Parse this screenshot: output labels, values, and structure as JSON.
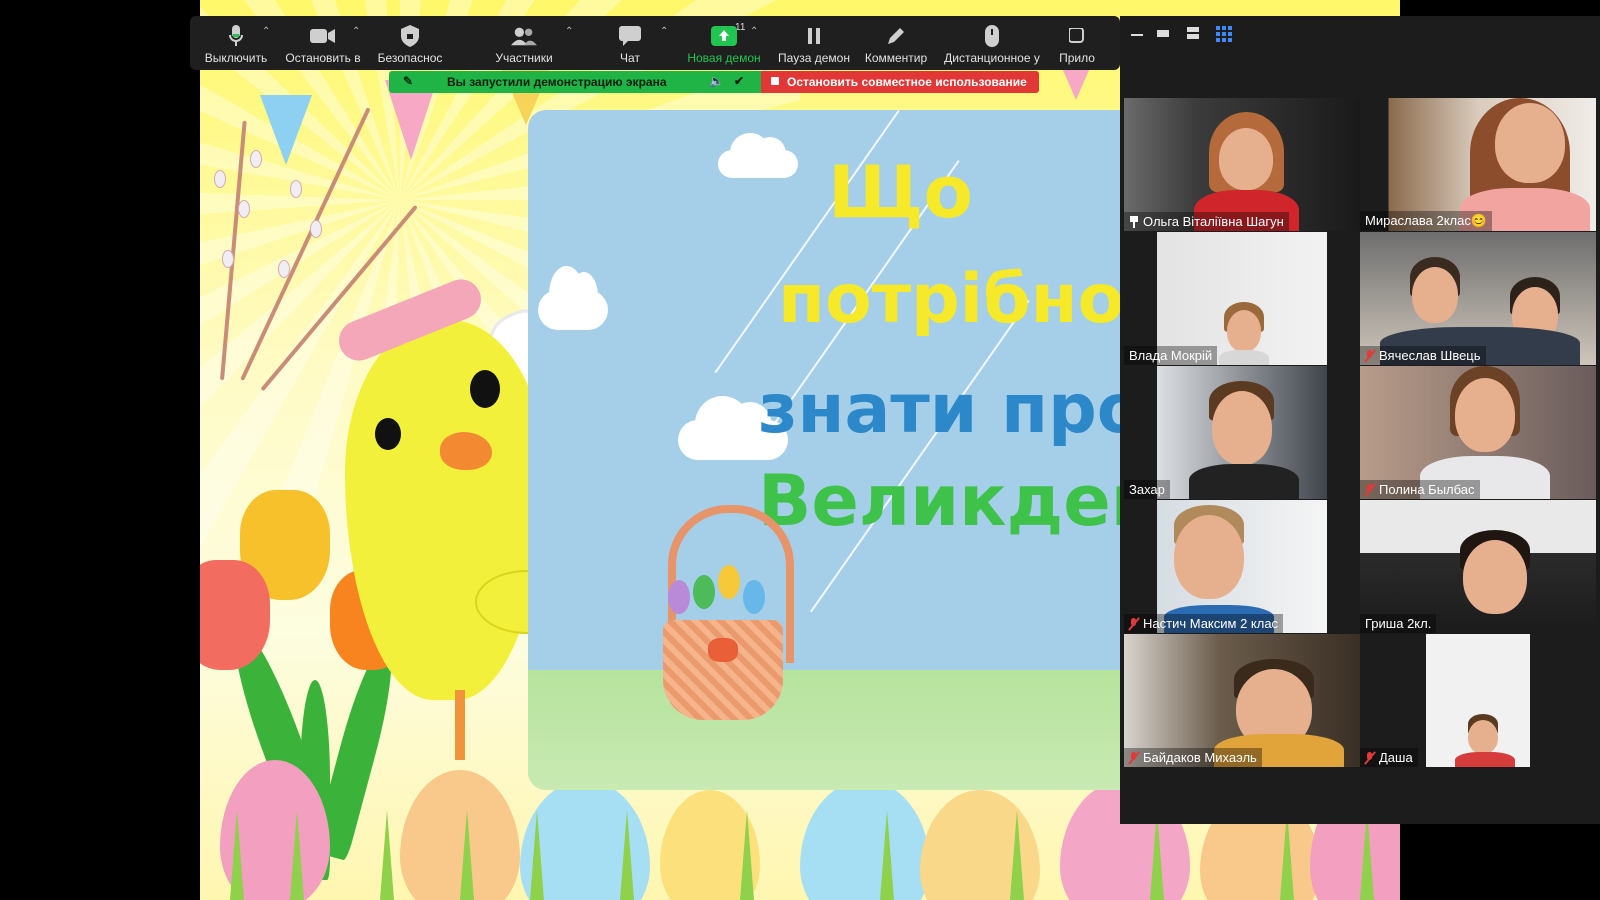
{
  "toolbar": {
    "items": [
      {
        "label": "Выключить",
        "icon": "microphone-icon"
      },
      {
        "label": "Остановить в",
        "icon": "video-camera-icon"
      },
      {
        "label": "Безопаснос",
        "icon": "shield-icon"
      },
      {
        "label": "Участники",
        "icon": "participants-icon",
        "count": "11"
      },
      {
        "label": "Чат",
        "icon": "chat-icon"
      },
      {
        "label": "Новая демон",
        "icon": "share-screen-icon",
        "accent": "#23c552"
      },
      {
        "label": "Пауза демон",
        "icon": "pause-icon"
      },
      {
        "label": "Комментир",
        "icon": "annotate-pencil-icon"
      },
      {
        "label": "Дистанционное у",
        "icon": "remote-control-mouse-icon"
      },
      {
        "label": "Прило",
        "icon": "apps-icon"
      }
    ]
  },
  "share_banner": {
    "text": "Вы запустили демонстрацию экрана",
    "stop_label": "Остановить совместное использование",
    "colors": {
      "banner": "#20b447",
      "stop": "#e13737"
    }
  },
  "video": {
    "title_lines": [
      "Що",
      "потрібно",
      "знати про",
      "Великдень"
    ]
  },
  "gallery": {
    "participants": [
      {
        "name": "Ольга Віталіївна Шагун",
        "pinned": true,
        "muted": false,
        "active": true
      },
      {
        "name": "Мираслава 2клас😊",
        "pinned": false,
        "muted": false
      },
      {
        "name": "Влада Мокрій",
        "pinned": false,
        "muted": false
      },
      {
        "name": "Вячеслав Швець",
        "pinned": false,
        "muted": true
      },
      {
        "name": "Захар",
        "pinned": false,
        "muted": false
      },
      {
        "name": "Полина Былбас",
        "pinned": false,
        "muted": true
      },
      {
        "name": "Настич Максим 2 клас",
        "pinned": false,
        "muted": true
      },
      {
        "name": "Гриша 2кл.",
        "pinned": false,
        "muted": false
      },
      {
        "name": "Байдаков Михаэль",
        "pinned": false,
        "muted": true
      },
      {
        "name": "Даша",
        "pinned": false,
        "muted": true
      }
    ]
  }
}
